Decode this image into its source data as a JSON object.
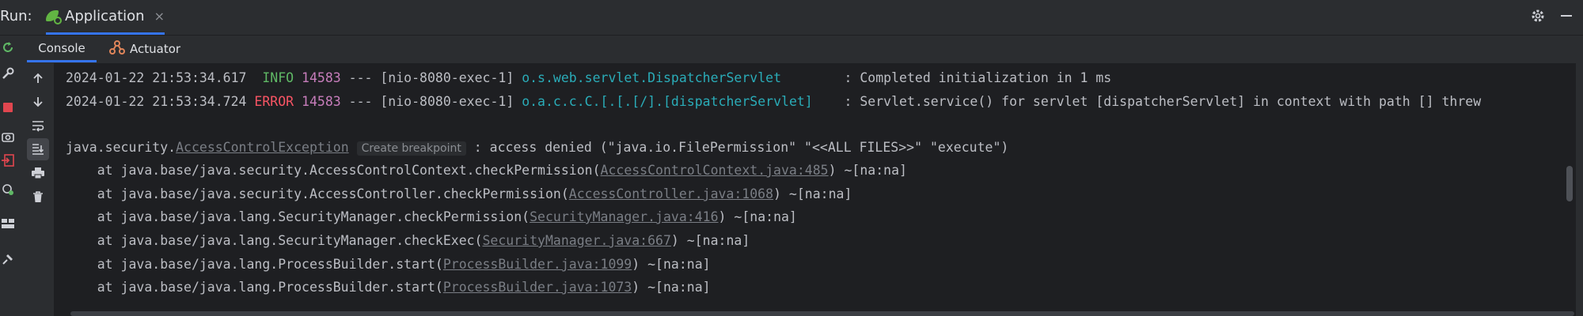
{
  "run_header": {
    "label": "Run:",
    "tab_title": "Application",
    "tab_close": "×"
  },
  "sub_tabs": {
    "console": "Console",
    "actuator": "Actuator"
  },
  "log_lines": [
    {
      "timestamp": "2024-01-22 21:53:34.617",
      "level": " INFO",
      "pid": "14583",
      "thread": " --- [nio-8080-exec-1] ",
      "logger": "o.s.web.servlet.DispatcherServlet       ",
      "message": " : Completed initialization in 1 ms"
    },
    {
      "timestamp": "2024-01-22 21:53:34.724",
      "level": "ERROR",
      "pid": "14583",
      "thread": " --- [nio-8080-exec-1] ",
      "logger": "o.a.c.c.C.[.[.[/].[dispatcherServlet]   ",
      "message": " : Servlet.service() for servlet [dispatcherServlet] in context with path [] threw"
    }
  ],
  "exception": {
    "prefix": "java.security.",
    "class_name": "AccessControlException",
    "breakpoint_hint": "Create breakpoint",
    "message": " : access denied (\"java.io.FilePermission\" \"<<ALL FILES>>\" \"execute\")"
  },
  "stack_frames": [
    {
      "prefix": "    at java.base/java.security.AccessControlContext.checkPermission(",
      "link": "AccessControlContext.java:485",
      "suffix": ") ~[na:na]"
    },
    {
      "prefix": "    at java.base/java.security.AccessController.checkPermission(",
      "link": "AccessController.java:1068",
      "suffix": ") ~[na:na]"
    },
    {
      "prefix": "    at java.base/java.lang.SecurityManager.checkPermission(",
      "link": "SecurityManager.java:416",
      "suffix": ") ~[na:na]"
    },
    {
      "prefix": "    at java.base/java.lang.SecurityManager.checkExec(",
      "link": "SecurityManager.java:667",
      "suffix": ") ~[na:na]"
    },
    {
      "prefix": "    at java.base/java.lang.ProcessBuilder.start(",
      "link": "ProcessBuilder.java:1099",
      "suffix": ") ~[na:na]"
    },
    {
      "prefix": "    at java.base/java.lang.ProcessBuilder.start(",
      "link": "ProcessBuilder.java:1073",
      "suffix": ") ~[na:na]"
    }
  ],
  "colors": {
    "accent": "#3574f0",
    "info": "#5fb865",
    "error": "#f75464",
    "pid": "#c77dbb",
    "logger": "#2aacb8",
    "console_bg": "#1e1f22",
    "panel_bg": "#2b2d30"
  },
  "icons": {
    "left_toolbar": [
      "rerun-icon",
      "wrench-icon",
      "stop-icon",
      "camera-icon",
      "exit-icon",
      "debug-icon",
      "layout-icon",
      "pin-icon"
    ],
    "console_toolbar": [
      "up-arrow-icon",
      "down-arrow-icon",
      "soft-wrap-icon",
      "scroll-to-end-icon",
      "print-icon",
      "trash-icon"
    ],
    "top_right": [
      "gear-icon",
      "minimize-icon"
    ]
  }
}
